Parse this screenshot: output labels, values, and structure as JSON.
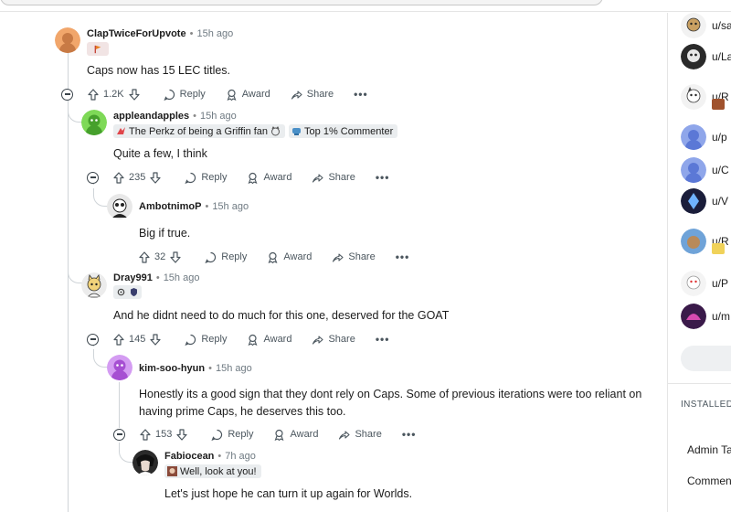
{
  "colors": {
    "upvote_gray": "#4b565e",
    "rail": "#cfd4d8",
    "flair_bg": "#eaedef",
    "username": "#1c1c1c",
    "timestamp": "#6f7a82"
  },
  "action_labels": {
    "reply": "Reply",
    "award": "Award",
    "share": "Share",
    "more": "•••"
  },
  "comments": [
    {
      "username": "ClapTwiceForUpvote",
      "time": "15h ago",
      "avatar": "orange-snoo-avatar",
      "flair_icons": [
        "flag-icon"
      ],
      "text": "Caps now has 15 LEC titles.",
      "score": "1.2K"
    },
    {
      "username": "appleandapples",
      "time": "15h ago",
      "avatar": "green-snoo-avatar",
      "flairs": [
        "The Perkz of being a Griffin fan",
        "Top 1% Commenter"
      ],
      "text": "Quite a few, I think",
      "score": "235"
    },
    {
      "username": "AmbotnimoP",
      "time": "15h ago",
      "avatar": "panda-snoo-avatar",
      "text": "Big if true.",
      "score": "32"
    },
    {
      "username": "Dray991",
      "time": "15h ago",
      "avatar": "cat-snoo-avatar",
      "flair_icons": [
        "gear-icon",
        "shield-icon"
      ],
      "text": "And he didnt need to do much for this one, deserved for the GOAT",
      "score": "145"
    },
    {
      "username": "kim-soo-hyun",
      "time": "15h ago",
      "avatar": "purple-snoo-avatar",
      "text": "Honestly its a good sign that they dont rely on Caps. Some of previous iterations were too reliant on having prime Caps, he deserves this too.",
      "score": "153"
    },
    {
      "username": "Fabiocean",
      "time": "7h ago",
      "avatar": "anime-avatar",
      "flairs": [
        "Well, look at you!"
      ],
      "text": "Let's just hope he can turn it up again for Worlds."
    }
  ],
  "sidebar": {
    "users": [
      "u/sa",
      "u/La",
      "u/R",
      "u/p",
      "u/C",
      "u/V",
      "u/R",
      "u/P",
      "u/m"
    ],
    "installed_heading": "INSTALLED",
    "links": [
      "Admin Ta",
      "Commen"
    ]
  }
}
